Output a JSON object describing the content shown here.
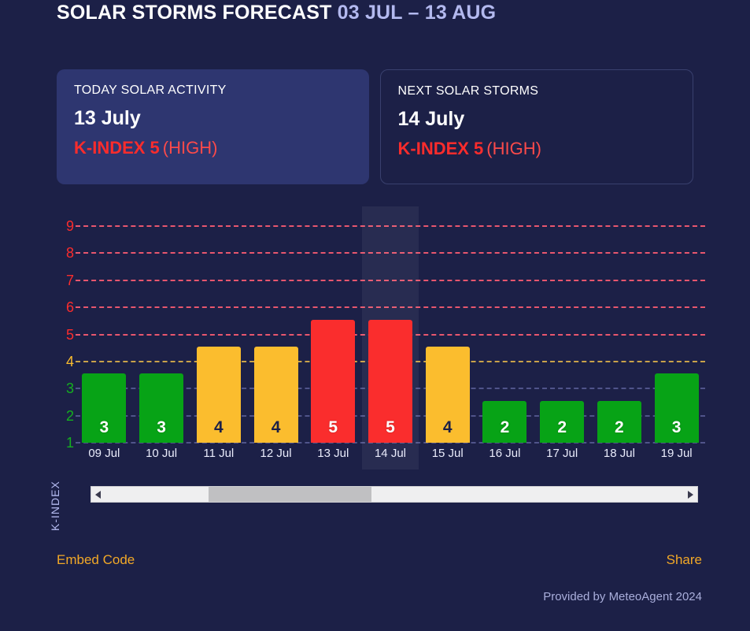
{
  "header": {
    "title": "SOLAR STORMS FORECAST",
    "date_range": "03 JUL – 13 AUG"
  },
  "cards": [
    {
      "title": "TODAY SOLAR ACTIVITY",
      "date": "13 July",
      "k_label": "K-INDEX 5",
      "k_level": "(HIGH)",
      "style": "filled"
    },
    {
      "title": "NEXT SOLAR STORMS",
      "date": "14 July",
      "k_label": "K-INDEX 5",
      "k_level": "(HIGH)",
      "style": "outlined"
    }
  ],
  "colors": {
    "page_bg": "#1c2047",
    "card_filled_bg": "#2e3670",
    "card_outline": "#39406e",
    "green": "#07a316",
    "amber": "#fbbd2e",
    "red": "#fa2d2d",
    "accent_link": "#f2a827",
    "muted_text": "#b3b9ef",
    "grid_red": "#e8566e",
    "grid_amber": "#c9a24a",
    "grid_blue": "#50548a"
  },
  "chart_data": {
    "type": "bar",
    "title": "SOLAR STORMS FORECAST 03 JUL – 13 AUG",
    "xlabel": "",
    "ylabel": "K-INDEX",
    "ylim": [
      0,
      9.5
    ],
    "yticks": [
      1,
      2,
      3,
      4,
      5,
      6,
      7,
      8,
      9
    ],
    "ytick_colors": [
      "#14b01f",
      "#14b01f",
      "#14b01f",
      "#fbbd2e",
      "#fb2c2c",
      "#fb2c2c",
      "#fb2c2c",
      "#fb2c2c",
      "#fb2c2c"
    ],
    "grid": true,
    "grid_style": "dashed",
    "legend": "none",
    "categories": [
      "09 Jul",
      "10 Jul",
      "11 Jul",
      "12 Jul",
      "13 Jul",
      "14 Jul",
      "15 Jul",
      "16 Jul",
      "17 Jul",
      "18 Jul",
      "19 Jul"
    ],
    "values": [
      3,
      3,
      4,
      4,
      5,
      5,
      4,
      2,
      2,
      2,
      3
    ],
    "bar_colors": [
      "#07a316",
      "#07a316",
      "#fbbd2e",
      "#fbbd2e",
      "#fa2d2d",
      "#fa2d2d",
      "#fbbd2e",
      "#07a316",
      "#07a316",
      "#07a316",
      "#07a316"
    ],
    "label_colors": [
      "light",
      "light",
      "dark",
      "dark",
      "light",
      "light",
      "dark",
      "light",
      "light",
      "light",
      "light"
    ],
    "highlighted_category": "14 Jul",
    "annotations": [
      "Bars labelled with K-index value inside bar"
    ]
  },
  "scrollbar": {
    "left_arrow": "◀",
    "right_arrow": "▶",
    "thumb_start_pct": 18,
    "thumb_width_pct": 28
  },
  "footer": {
    "embed_code": "Embed Code",
    "share": "Share",
    "provided_by": "Provided by MeteoAgent 2024"
  }
}
